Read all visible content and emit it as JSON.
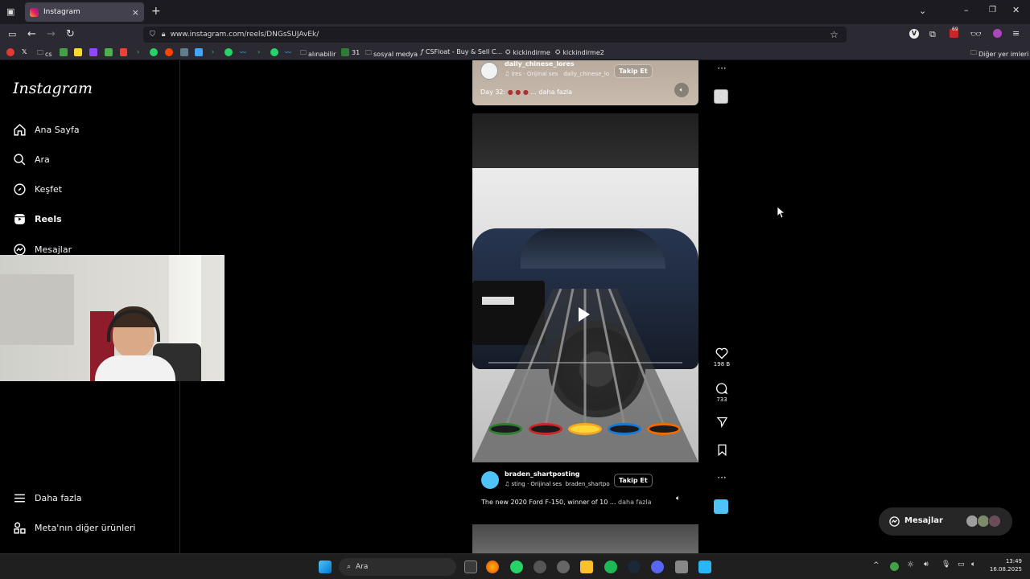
{
  "browser": {
    "tab_title": "Instagram",
    "url": "www.instagram.com/reels/DNGsSUJAvEk/",
    "bookmarks": [
      "cs",
      "alınabilir",
      "31",
      "sosyal medya",
      "CSFloat - Buy & Sell C...",
      "kickindirme",
      "kickindirme2"
    ],
    "other_bookmarks": "Diğer yer imleri",
    "badge_count": "69"
  },
  "sidebar": {
    "logo": "Instagram",
    "items": [
      {
        "label": "Ana Sayfa"
      },
      {
        "label": "Ara"
      },
      {
        "label": "Keşfet"
      },
      {
        "label": "Reels"
      },
      {
        "label": "Mesajlar"
      }
    ],
    "more": "Daha fazla",
    "meta": "Meta'nın diğer ürünleri"
  },
  "reel_top": {
    "username": "daily_chinese_lores",
    "audio": "ires · Orijinal ses",
    "audio_tag": "daily_chinese_lo",
    "follow": "Takip Et",
    "caption": "Day 32:",
    "more": "... daha fazla"
  },
  "reel_main": {
    "username": "braden_shartposting",
    "audio": "sting · Orijinal ses",
    "audio_tag": "braden_shartpo",
    "follow": "Takip Et",
    "caption": "The new 2020 Ford F-150, winner of 10 ...",
    "more": "daha fazla",
    "likes": "198 B",
    "comments": "733"
  },
  "messages_pill": {
    "label": "Mesajlar"
  },
  "taskbar": {
    "search": "Ara",
    "time": "13:49",
    "date": "16.08.2025"
  },
  "colors": {
    "accent": "#0095f6",
    "bg": "#000000",
    "chrome": "#2b2a33"
  }
}
